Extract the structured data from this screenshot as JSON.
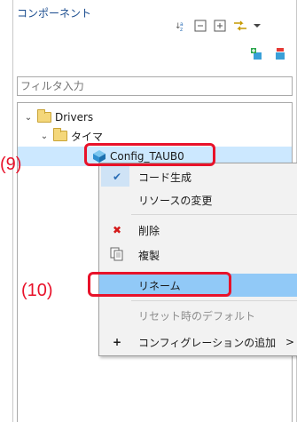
{
  "panel": {
    "title": "コンポーネント",
    "toolbar_icons": [
      "sort-az-icon",
      "collapse-all-icon",
      "expand-all-icon",
      "link-icon",
      "view-menu-icon"
    ],
    "actions": [
      "add-component-icon",
      "remove-component-icon"
    ]
  },
  "filter": {
    "placeholder": "フィルタ入力"
  },
  "tree": {
    "drivers_label": "Drivers",
    "timer_label": "タイマ",
    "config_label": "Config_TAUB0"
  },
  "annotations": {
    "a9": "(9)",
    "a10": "(10)"
  },
  "context_menu": {
    "items": [
      {
        "label": "コード生成",
        "icon": "✔",
        "checked": true
      },
      {
        "label": "リソースの変更",
        "icon": ""
      },
      {
        "label": "削除",
        "icon": "✖"
      },
      {
        "label": "複製",
        "icon": "copy"
      },
      {
        "label": "リネーム",
        "icon": "",
        "highlighted": true
      },
      {
        "label": "リセット時のデフォルト",
        "icon": "",
        "disabled": true
      },
      {
        "label": "コンフィグレーションの追加",
        "icon": "+",
        "submenu_arrow": ">"
      }
    ]
  },
  "colors": {
    "accent_red": "#e8122a",
    "selection": "#cce8ff",
    "menu_highlight": "#91c9f7"
  }
}
